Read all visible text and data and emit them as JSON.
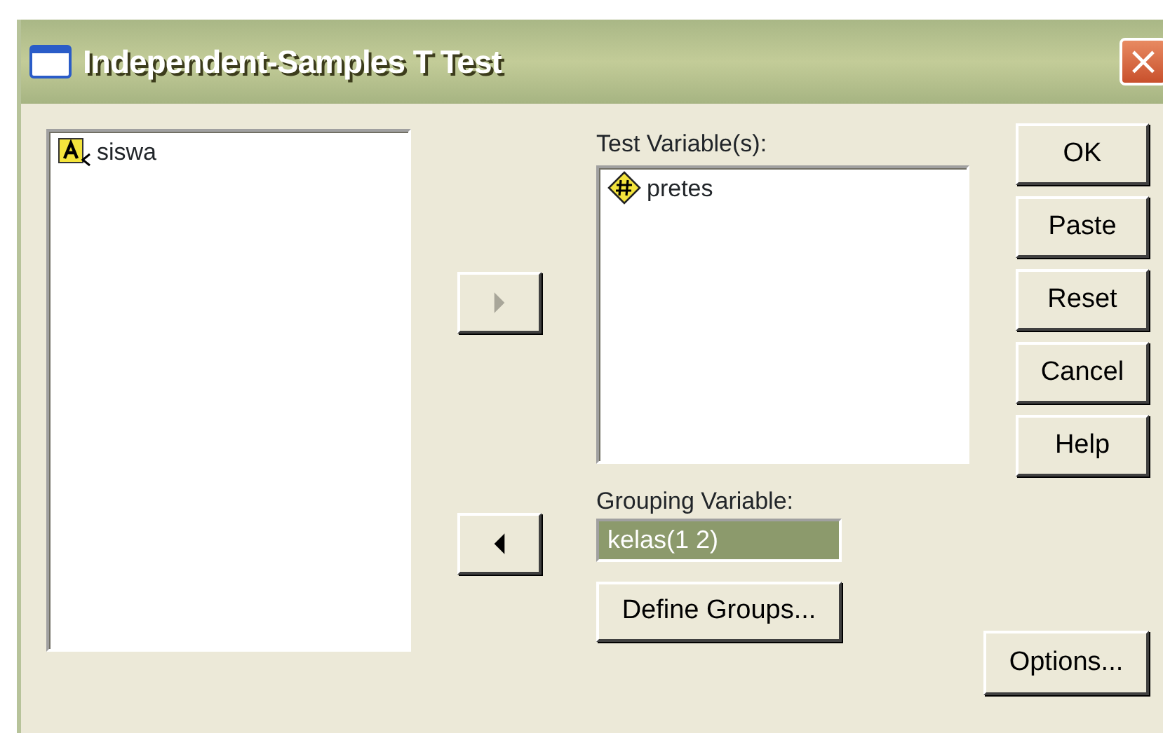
{
  "window": {
    "title": "Independent-Samples T Test",
    "close": "×"
  },
  "source_list": {
    "items": [
      {
        "label": "siswa",
        "kind": "string"
      }
    ]
  },
  "move_buttons": [
    {
      "kind": "right",
      "disabled": true
    },
    {
      "kind": "left",
      "disabled": false
    }
  ],
  "test_variables": {
    "label": "Test Variable(s):",
    "items": [
      {
        "label": "pretes",
        "kind": "scale"
      }
    ]
  },
  "grouping_variable": {
    "label": "Grouping Variable:",
    "value": "kelas(1 2)",
    "selected": true
  },
  "define_groups_button": "Define Groups...",
  "buttons": [
    "OK",
    "Paste",
    "Reset",
    "Cancel",
    "Help"
  ],
  "options_button": "Options..."
}
